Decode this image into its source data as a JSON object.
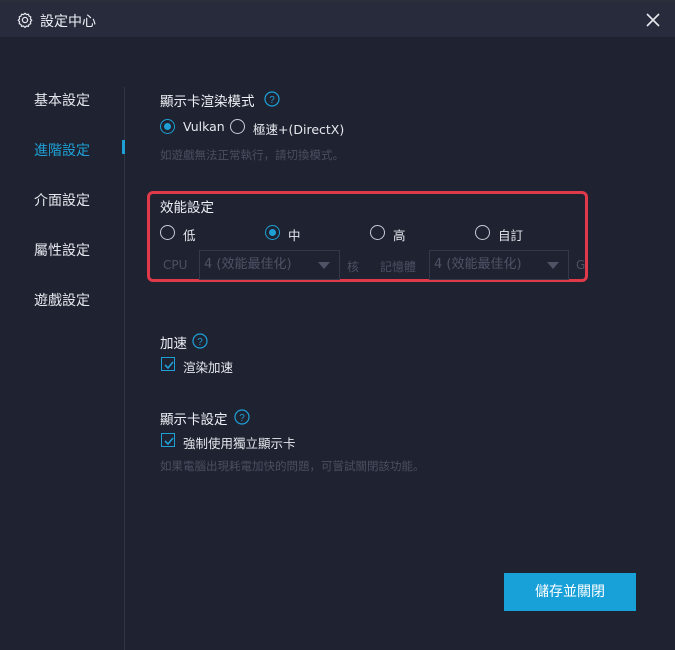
{
  "window": {
    "title": "設定中心",
    "icons": {
      "title": "gear-icon",
      "close": "close-icon"
    }
  },
  "sidebar": {
    "items": [
      {
        "label": "基本設定",
        "active": false
      },
      {
        "label": "進階設定",
        "active": true
      },
      {
        "label": "介面設定",
        "active": false
      },
      {
        "label": "屬性設定",
        "active": false
      },
      {
        "label": "遊戲設定",
        "active": false
      }
    ]
  },
  "render_mode": {
    "title": "顯示卡渲染模式",
    "options": [
      {
        "label": "Vulkan",
        "selected": true
      },
      {
        "label": "極速+(DirectX)",
        "selected": false
      }
    ],
    "hint": "如遊戲無法正常執行，請切換模式。"
  },
  "performance": {
    "title": "效能設定",
    "options": [
      {
        "label": "低",
        "selected": false
      },
      {
        "label": "中",
        "selected": true
      },
      {
        "label": "高",
        "selected": false
      },
      {
        "label": "自訂",
        "selected": false
      }
    ],
    "cpu_label": "CPU",
    "cpu_value": "4 (效能最佳化)",
    "cpu_unit": "核",
    "memory_label": "記憶體",
    "memory_value": "4 (效能最佳化)",
    "memory_unit": "GB"
  },
  "acceleration": {
    "title": "加速",
    "checkbox_label": "渲染加速",
    "checked": true
  },
  "gpu": {
    "title": "顯示卡設定",
    "checkbox_label": "強制使用獨立顯示卡",
    "checked": true,
    "hint": "如果電腦出現耗電加快的問題，可嘗試關閉該功能。"
  },
  "footer": {
    "save_label": "儲存並關閉"
  },
  "colors": {
    "accent": "#1ea0d6",
    "highlight": "#e0394a",
    "background": "#1f2230",
    "titlebar": "#272b3b"
  }
}
